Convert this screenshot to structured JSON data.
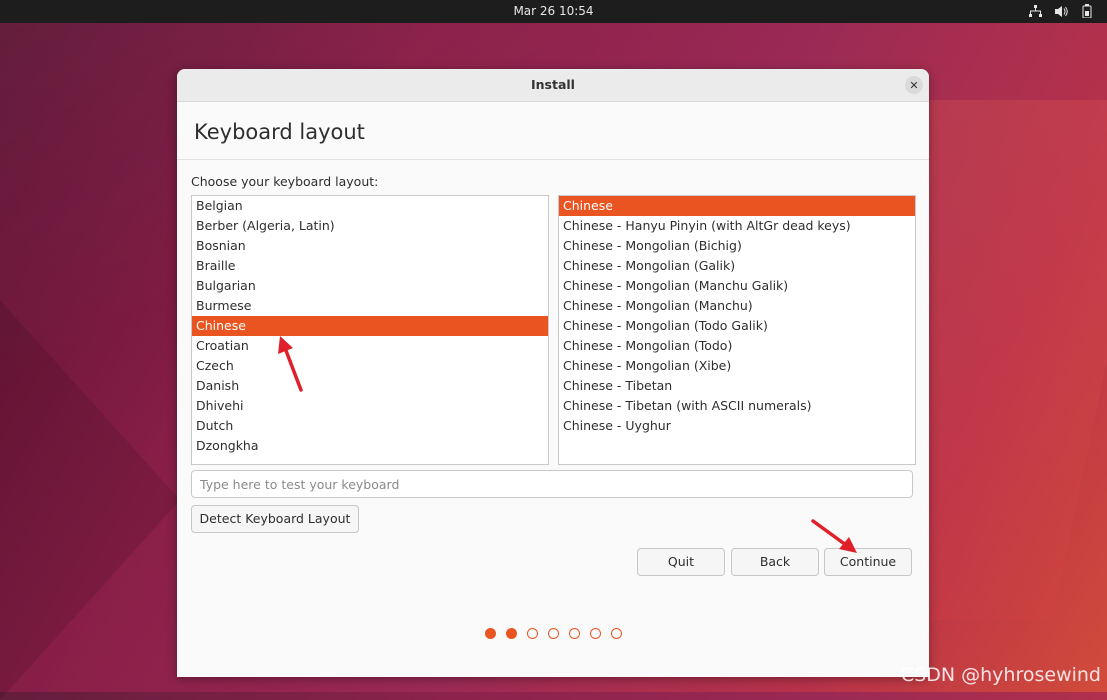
{
  "topbar": {
    "datetime": "Mar 26  10:54",
    "tray_icons": [
      "network-icon",
      "volume-icon",
      "battery-icon"
    ]
  },
  "window": {
    "title": "Install",
    "page_title": "Keyboard layout",
    "prompt": "Choose your keyboard layout:",
    "layouts": [
      {
        "label": "Belgian"
      },
      {
        "label": "Berber (Algeria, Latin)"
      },
      {
        "label": "Bosnian"
      },
      {
        "label": "Braille"
      },
      {
        "label": "Bulgarian"
      },
      {
        "label": "Burmese"
      },
      {
        "label": "Chinese",
        "selected": true
      },
      {
        "label": "Croatian"
      },
      {
        "label": "Czech"
      },
      {
        "label": "Danish"
      },
      {
        "label": "Dhivehi"
      },
      {
        "label": "Dutch"
      },
      {
        "label": "Dzongkha"
      }
    ],
    "variants": [
      {
        "label": "Chinese",
        "selected": true
      },
      {
        "label": "Chinese - Hanyu Pinyin (with AltGr dead keys)"
      },
      {
        "label": "Chinese - Mongolian (Bichig)"
      },
      {
        "label": "Chinese - Mongolian (Galik)"
      },
      {
        "label": "Chinese - Mongolian (Manchu Galik)"
      },
      {
        "label": "Chinese - Mongolian (Manchu)"
      },
      {
        "label": "Chinese - Mongolian (Todo Galik)"
      },
      {
        "label": "Chinese - Mongolian (Todo)"
      },
      {
        "label": "Chinese - Mongolian (Xibe)"
      },
      {
        "label": "Chinese - Tibetan"
      },
      {
        "label": "Chinese - Tibetan (with ASCII numerals)"
      },
      {
        "label": "Chinese - Uyghur"
      }
    ],
    "test_placeholder": "Type here to test your keyboard",
    "test_value": "",
    "detect_label": "Detect Keyboard Layout",
    "quit_label": "Quit",
    "back_label": "Back",
    "continue_label": "Continue",
    "progress": {
      "current_step": 2,
      "total_steps": 7
    }
  },
  "colors": {
    "accent": "#e95420",
    "annotation_arrow": "#e0202a"
  },
  "watermark": "CSDN @hyhrosewind"
}
